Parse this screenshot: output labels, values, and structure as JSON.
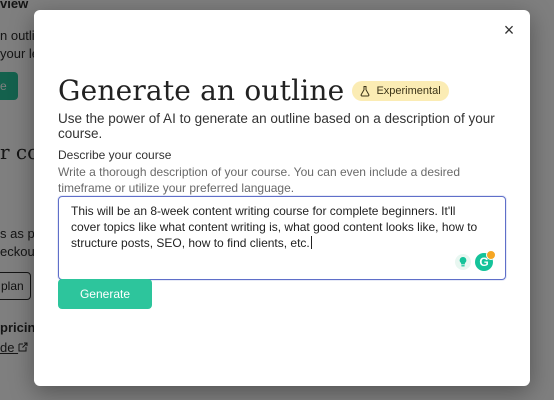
{
  "background_page": {
    "fragment_1": "view",
    "fragment_2": "n outli",
    "fragment_3": "your le",
    "fragment_4": "e",
    "fragment_5": "r cov",
    "fragment_6": "s as pa",
    "fragment_7": "eckout",
    "fragment_8": "plan",
    "fragment_9": "pricin",
    "fragment_10": "de"
  },
  "modal": {
    "close_glyph": "×",
    "title": "Generate an outline",
    "badge_label": "Experimental",
    "subtitle": "Use the power of AI to generate an outline based on a description of your course.",
    "field_label": "Describe your course",
    "field_help": "Write a thorough description of your course. You can even include a desired timeframe or utilize your preferred language.",
    "field_value": "This will be an 8-week content writing course for complete beginners. It'll cover topics like what content writing is, what good content looks like, how to structure posts, SEO, how to find clients, etc.",
    "assistant_letter": "G",
    "generate_label": "Generate"
  },
  "colors": {
    "accent_green": "#2dc59c",
    "badge_bg": "#fbecb4",
    "focus_border": "#5f6fc9"
  },
  "icons": [
    "close-icon",
    "flask-icon",
    "lightbulb-icon",
    "grammarly-icon",
    "external-link-icon"
  ]
}
